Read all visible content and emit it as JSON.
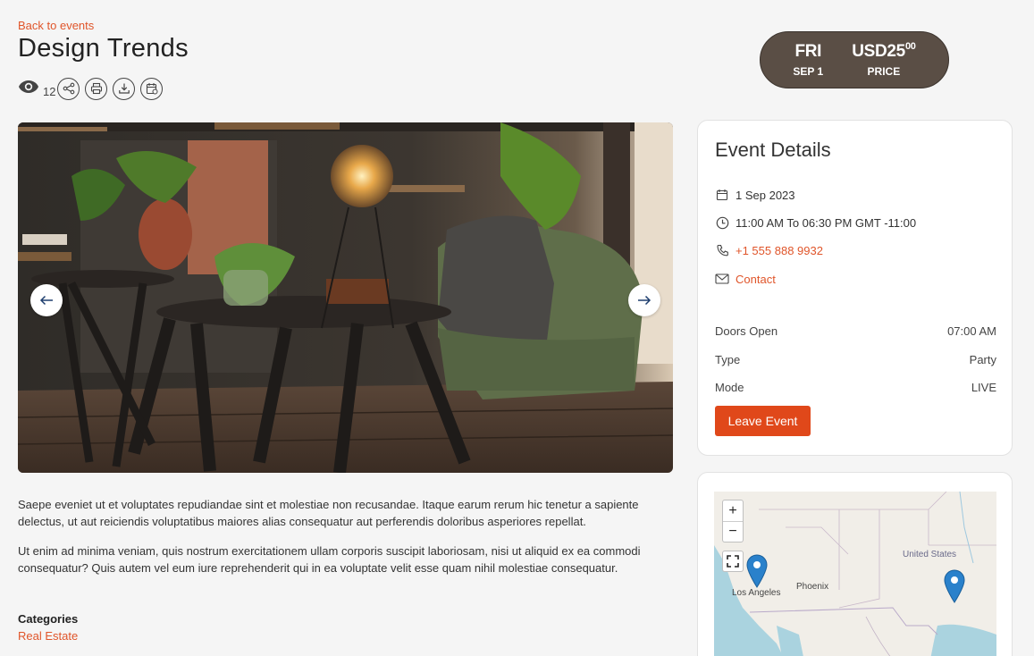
{
  "header": {
    "back_label": "Back to events",
    "title": "Design Trends",
    "views_count": "12"
  },
  "date_pill": {
    "day": "FRI",
    "date": "SEP 1",
    "price_currency_main": "USD25",
    "price_cents": "00",
    "price_label": "PRICE"
  },
  "description": {
    "p1": "Saepe eveniet ut et voluptates repudiandae sint et molestiae non recusandae. Itaque earum rerum hic tenetur a sapiente delectus, ut aut reiciendis voluptatibus maiores alias consequatur aut perferendis doloribus asperiores repellat.",
    "p2": "Ut enim ad minima veniam, quis nostrum exercitationem ullam corporis suscipit laboriosam, nisi ut aliquid ex ea commodi consequatur? Quis autem vel eum iure reprehenderit qui in ea voluptate velit esse quam nihil molestiae consequatur."
  },
  "categories": {
    "label": "Categories",
    "value": "Real Estate"
  },
  "details": {
    "title": "Event Details",
    "date": "1 Sep 2023",
    "time": "11:00 AM To 06:30 PM GMT -11:00",
    "phone": "+1 555 888 9932",
    "contact": "Contact",
    "doors_open_label": "Doors Open",
    "doors_open_value": "07:00 AM",
    "type_label": "Type",
    "type_value": "Party",
    "mode_label": "Mode",
    "mode_value": "LIVE",
    "leave_button": "Leave Event"
  },
  "map": {
    "zoom_in": "+",
    "zoom_out": "−",
    "labels": {
      "los_angeles": "Los Angeles",
      "phoenix": "Phoenix",
      "united_states": "United States"
    }
  },
  "colors": {
    "accent": "#e0552a",
    "button": "#e0481a",
    "pill": "#5a4e45",
    "marker": "#2a81cb"
  }
}
